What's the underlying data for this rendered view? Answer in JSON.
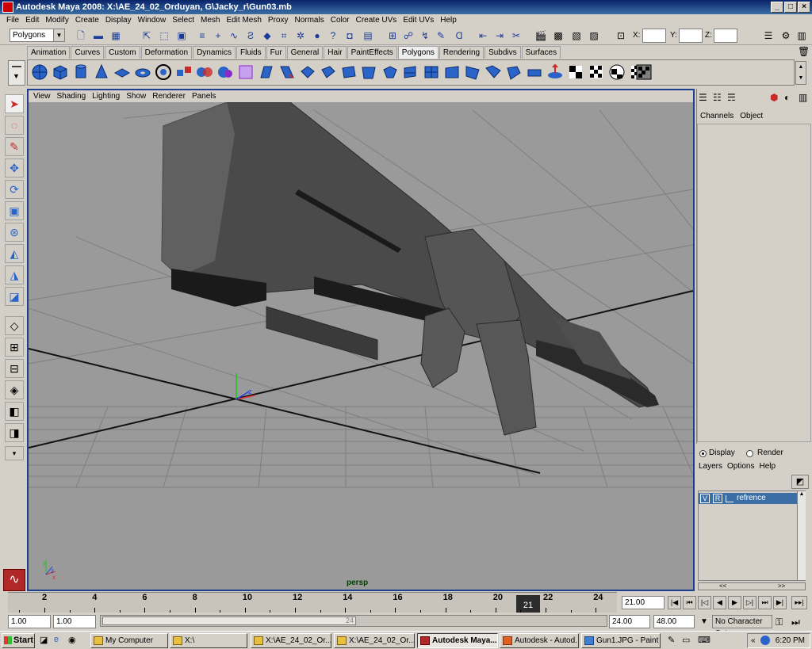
{
  "window": {
    "title": "Autodesk Maya 2008: X:\\AE_24_02_Orduyan, G\\Jacky_r\\Gun03.mb"
  },
  "menubar": [
    "File",
    "Edit",
    "Modify",
    "Create",
    "Display",
    "Window",
    "Select",
    "Mesh",
    "Edit Mesh",
    "Proxy",
    "Normals",
    "Color",
    "Create UVs",
    "Edit UVs",
    "Help"
  ],
  "statusline": {
    "menu_set": "Polygons",
    "x_label": "X:",
    "y_label": "Y:",
    "z_label": "Z:"
  },
  "shelf_tabs": [
    "Animation",
    "Curves",
    "Custom",
    "Deformation",
    "Dynamics",
    "Fluids",
    "Fur",
    "General",
    "Hair",
    "PaintEffects",
    "Polygons",
    "Rendering",
    "Subdivs",
    "Surfaces"
  ],
  "shelf_active": "Polygons",
  "viewport": {
    "menu": [
      "View",
      "Shading",
      "Lighting",
      "Show",
      "Renderer",
      "Panels"
    ],
    "camera_label": "persp",
    "axis_x": "x",
    "axis_y": "y",
    "axis_z": "z"
  },
  "channel_box": {
    "tabs": [
      "Channels",
      "Object"
    ]
  },
  "layer_editor": {
    "display_label": "Display",
    "render_label": "Render",
    "menu": [
      "Layers",
      "Options",
      "Help"
    ],
    "layers": [
      {
        "v": "V",
        "r": "R",
        "name": "refrence"
      }
    ],
    "scroll_left": "<<",
    "scroll_right": ">>"
  },
  "time_slider": {
    "ticks": [
      "2",
      "4",
      "6",
      "8",
      "10",
      "12",
      "14",
      "16",
      "18",
      "20",
      "22",
      "24"
    ],
    "current_frame": "21",
    "current_field": "21.00"
  },
  "range": {
    "start": "1.00",
    "range_start": "1.00",
    "range_handle_end": "24",
    "range_end": "24.00",
    "end": "48.00",
    "character_set": "No Character Set"
  },
  "taskbar": {
    "start_label": "Start",
    "buttons": [
      {
        "label": "My Computer",
        "active": false
      },
      {
        "label": "X:\\",
        "active": false
      },
      {
        "label": "X:\\AE_24_02_Or...",
        "active": false
      },
      {
        "label": "X:\\AE_24_02_Or...",
        "active": false
      },
      {
        "label": "Autodesk Maya...",
        "active": true
      },
      {
        "label": "Autodesk - Autod...",
        "active": false
      },
      {
        "label": "Gun1.JPG - Paint",
        "active": false
      }
    ],
    "clock": "6:20 PM"
  }
}
